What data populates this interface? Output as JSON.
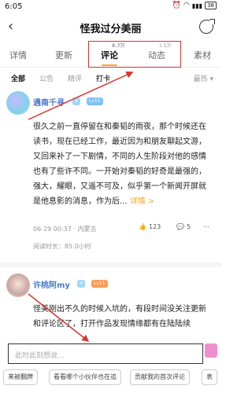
{
  "status": {
    "time": "6:05",
    "battery": "38"
  },
  "nav": {
    "title": "怪我过分美丽"
  },
  "tabs": [
    {
      "label": "详情",
      "count": ""
    },
    {
      "label": "更新",
      "count": ""
    },
    {
      "label": "评论",
      "count": "8.7万"
    },
    {
      "label": "动态",
      "count": "1.5万"
    },
    {
      "label": "素材",
      "count": ""
    }
  ],
  "filters": {
    "items": [
      "全部",
      "公告",
      "精评",
      "打卡"
    ],
    "sort": "最热"
  },
  "comments": [
    {
      "name": "遇南千寻",
      "badges": [
        "V",
        "Lv15"
      ],
      "text": "很久之前一直停留在和秦韬的雨夜，那个时候还在读书，现在已经工作，最近因为和朋友聊起文游，又回来补了一下剧情，不同的人生阶段对他的感情也有了些许不同。一开始对秦韬的好奇是最强的，强大，耀眼，又遥不可及，似乎第一个新闻开屏就是他息影的消息，作为后...",
      "more": "详情 >",
      "meta": "06-29 00:37 · 内蒙古",
      "likes": "123",
      "replies": "5",
      "read_time": "阅读时长：85.0小时"
    },
    {
      "name": "许桃阿my",
      "badges": [
        "V",
        "Lv11"
      ],
      "text": "怪美刚出不久的时候入坑的，有段时间没关注更新和评论区了，打开作品发现情缘都有在陆陆续"
    }
  ],
  "input": {
    "placeholder": "此时此刻想说..."
  },
  "chips": [
    "来被翻牌",
    "看看哪个小伙伴也在追",
    "贡献我的首次评论",
    "表"
  ],
  "colors": {
    "accent": "#f5a623",
    "annotation": "#d9342b",
    "username": "#4a7bd0"
  }
}
